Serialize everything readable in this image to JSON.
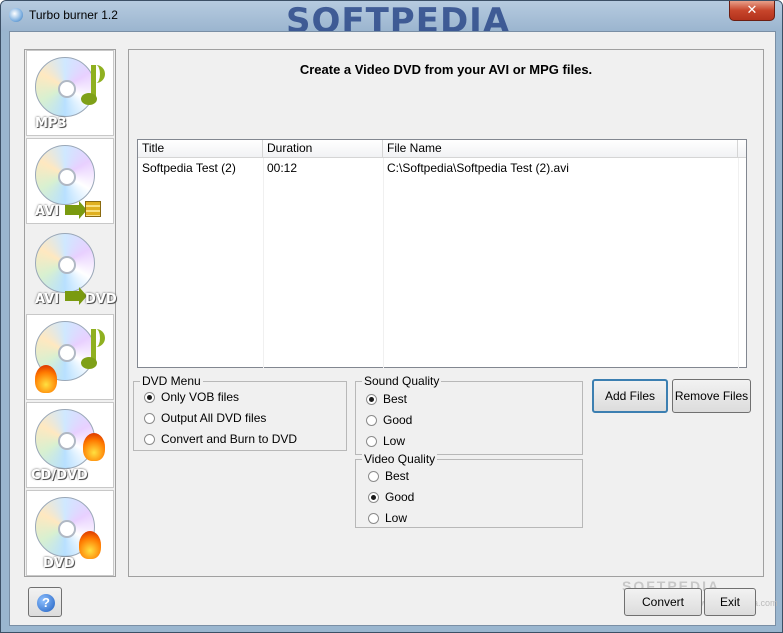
{
  "window": {
    "title": "Turbo burner 1.2",
    "watermark_title": "SOFTPEDIA",
    "close_label": "✕"
  },
  "sidebar": {
    "items": [
      {
        "label": "MP3",
        "icon": "disc-music-icon"
      },
      {
        "label": "AVI",
        "icon": "disc-avi-icon"
      },
      {
        "label": "AVI",
        "label2": "DVD",
        "icon": "disc-avi-to-dvd-icon"
      },
      {
        "label": "",
        "icon": "disc-music-burn-icon"
      },
      {
        "label": "CD/DVD",
        "icon": "disc-copy-burn-icon"
      },
      {
        "label": "DVD",
        "icon": "disc-dvd-burn-icon"
      }
    ],
    "selected_index": 2
  },
  "main": {
    "heading": "Create a Video DVD from your AVI or MPG files.",
    "list": {
      "columns": [
        "Title",
        "Duration",
        "File Name"
      ],
      "rows": [
        {
          "title": "Softpedia Test (2)",
          "duration": "00:12",
          "file": "C:\\Softpedia\\Softpedia Test (2).avi"
        }
      ]
    },
    "dvd_menu": {
      "legend": "DVD Menu",
      "options": [
        "Only VOB files",
        "Output All DVD files",
        "Convert and Burn to DVD"
      ],
      "selected": 0
    },
    "sound_quality": {
      "legend": "Sound Quality",
      "options": [
        "Best",
        "Good",
        "Low"
      ],
      "selected": 0
    },
    "video_quality": {
      "legend": "Video Quality",
      "options": [
        "Best",
        "Good",
        "Low"
      ],
      "selected": 1
    },
    "add_files_label": "Add Files",
    "remove_files_label": "Remove Files"
  },
  "footer": {
    "help_label": "?",
    "convert_label": "Convert",
    "exit_label": "Exit",
    "watermark": "SOFTPEDIA",
    "watermark_url": "www.softpedia.com"
  }
}
